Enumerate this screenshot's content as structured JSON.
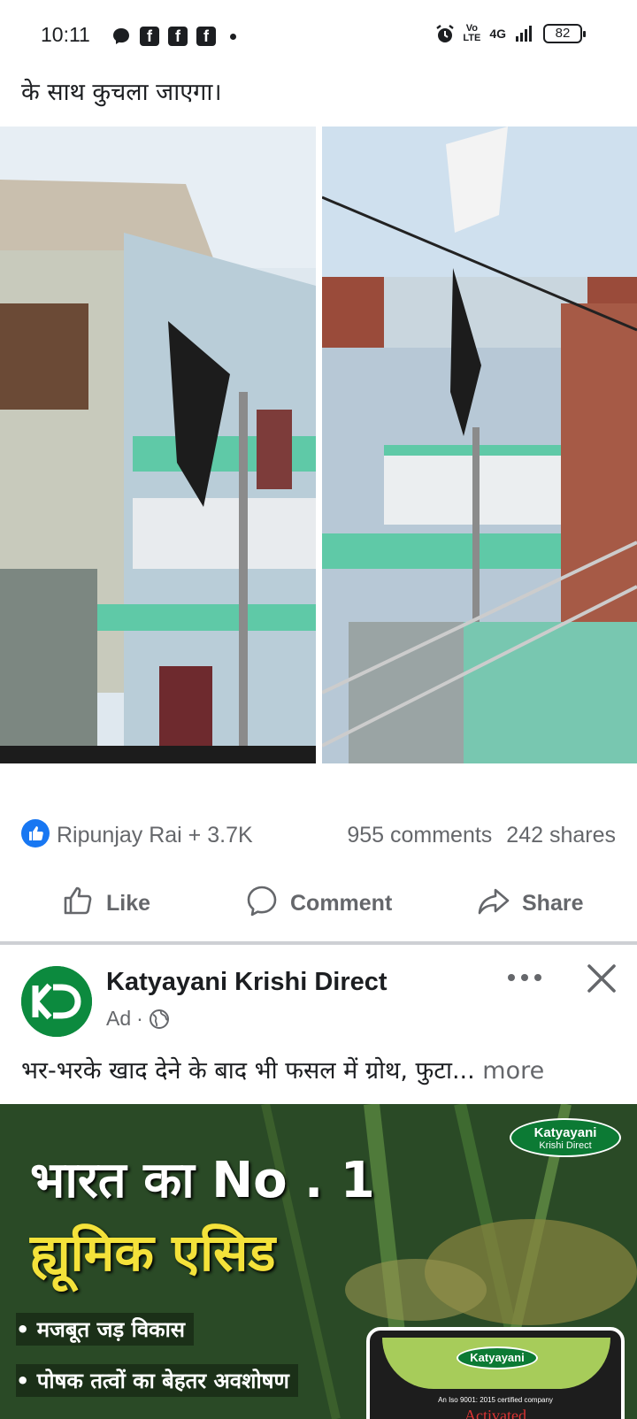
{
  "status_bar": {
    "time": "10:11",
    "volte_line1": "Vo",
    "volte_line2": "LTE",
    "network": "4G",
    "battery": "82"
  },
  "post": {
    "text": "के साथ कुचला जाएगा।",
    "reactor": "Ripunjay Rai + 3.7K",
    "comments": "955 comments",
    "shares": "242 shares",
    "actions": {
      "like": "Like",
      "comment": "Comment",
      "share": "Share"
    },
    "accent_color": "#1877f2"
  },
  "ad": {
    "advertiser": "Katyayani Krishi Direct",
    "label": "Ad",
    "separator": "·",
    "text": "भर-भरके खाद देने के बाद भी फसल में ग्रोथ, फुटा...",
    "more": " more",
    "creative": {
      "brand_line1": "Katyayani",
      "brand_line2": "Krishi Direct",
      "headline1": "भारत का No . 1",
      "headline2": "ह्यूमिक एसिड",
      "bullet1": "• मजबूत जड़ विकास",
      "bullet2": "• पोषक तत्वों का बेहतर अवशोषण",
      "bag_brand": "Katyayani",
      "bag_iso": "An Iso 9001: 2015 certified company",
      "bag_product": "Activated"
    }
  }
}
